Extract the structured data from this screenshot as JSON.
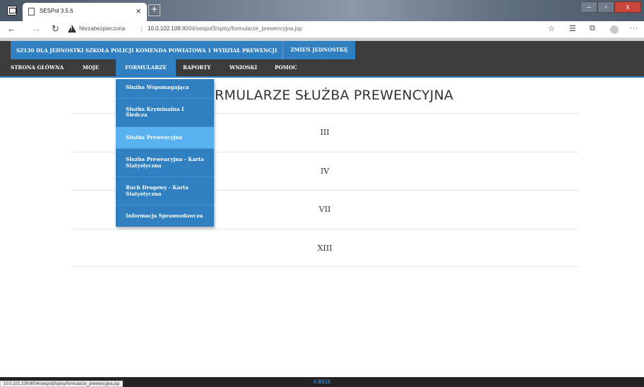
{
  "browser": {
    "tab_title": "SESPol 3.5.6",
    "tab_close": "×",
    "new_tab": "+",
    "security_label": "Niezabezpieczona",
    "separator": "|",
    "url_host": "10.0.102.109",
    "url_rest": ":8004/sespol3/spisy/formularze_prewencyjna.jsp",
    "window_controls": [
      "–",
      "▫",
      "x"
    ],
    "status_url": "10.0.102.109:8004/sespol3/spisy/formularze_prewencyjna.jsp"
  },
  "unitbar": {
    "unit_name": "SZ130 DLA JEDNOSTKI SZKOŁA POLICJI KOMENDA POWIATOWA 1 WYDZIAŁ PREWENCJI",
    "change_unit": "ZMIEŃ JEDNOSTKĘ"
  },
  "nav": {
    "items": [
      {
        "label": "STRONA GŁÓWNA"
      },
      {
        "label": "MOJE"
      },
      {
        "label": "FORMULARZE"
      },
      {
        "label": "RAPORTY"
      },
      {
        "label": "WNIOSKI"
      },
      {
        "label": "POMOC"
      }
    ],
    "active": "FORMULARZE"
  },
  "dropdown": {
    "items": [
      {
        "label": "Służba Wspomagająca"
      },
      {
        "label": "Służba Kryminalna I Śledcza"
      },
      {
        "label": "Służba Prewencyjna"
      },
      {
        "label": "Służba Prewencyjna - Karta Statystyczna"
      },
      {
        "label": "Ruch Drogowy - Karta Statystyczna"
      },
      {
        "label": "Informacja Sprawozdawcza"
      }
    ],
    "highlighted": "Służba Prewencyjna"
  },
  "main": {
    "heading": "FORMULARZE SŁUŻBA PREWENCYJNA",
    "rows": [
      "III",
      "IV",
      "VII",
      "XIII"
    ]
  },
  "footer": {
    "text": "©BŁIŁ"
  },
  "colors": {
    "accent": "#2f7fc1",
    "nav_bg": "#3c3c3c",
    "dropdown_hover": "#5ab1f0"
  },
  "icons": [
    "window-icon",
    "page-icon",
    "back-arrow-icon",
    "forward-arrow-icon",
    "refresh-icon",
    "warning-icon",
    "read-aloud-icon",
    "favorites-icon",
    "collections-icon",
    "profile-avatar",
    "more-icon"
  ]
}
